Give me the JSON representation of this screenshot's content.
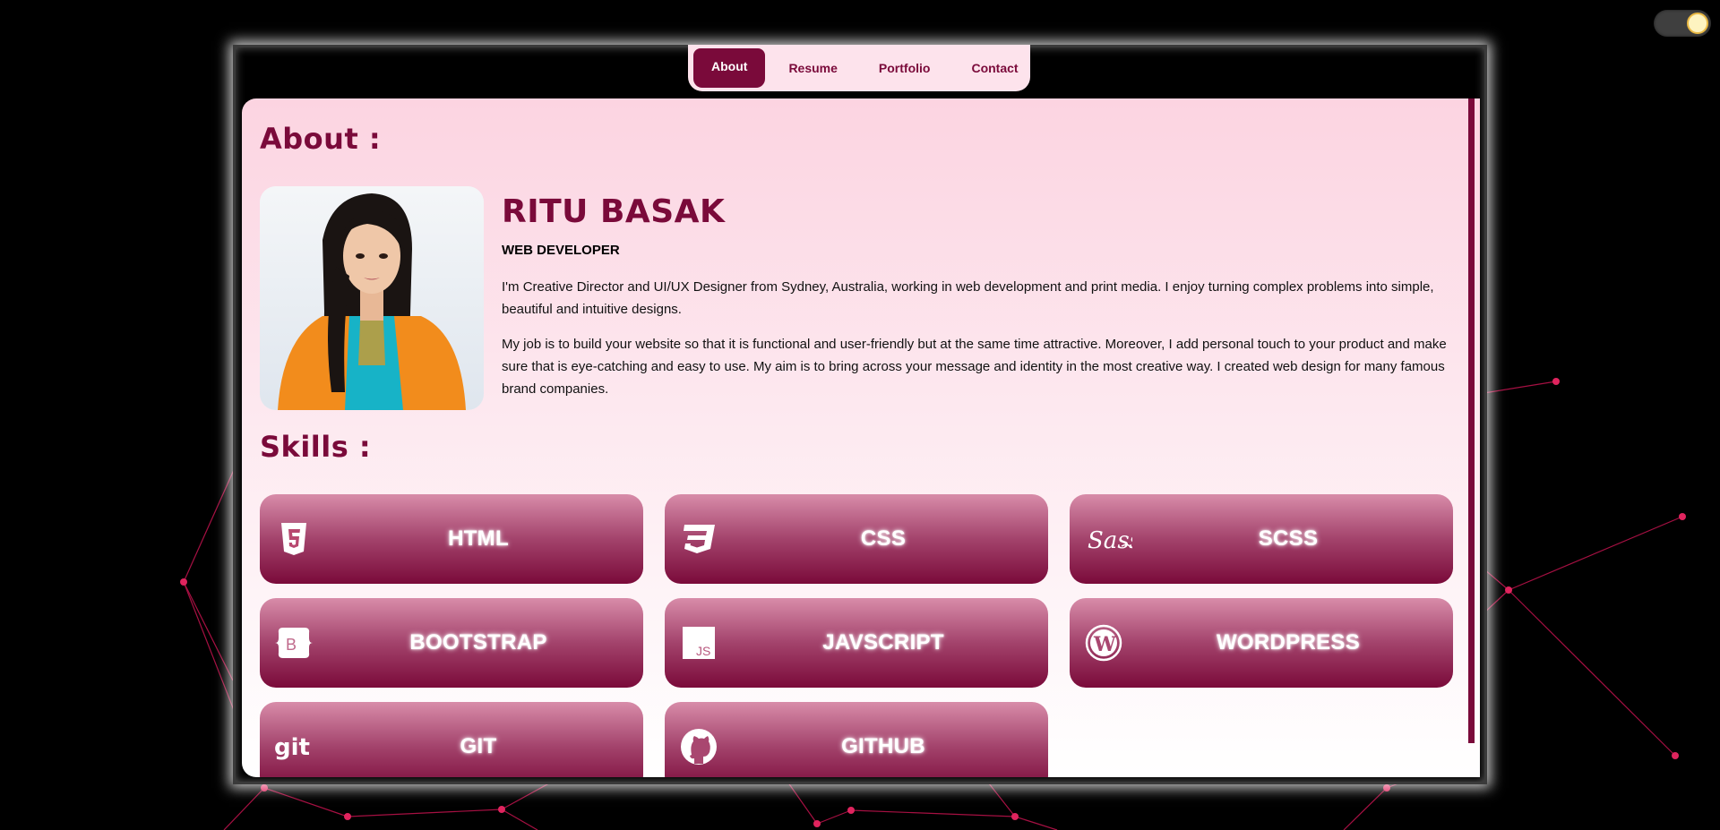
{
  "nav": {
    "items": [
      {
        "label": "About",
        "active": true
      },
      {
        "label": "Resume",
        "active": false
      },
      {
        "label": "Portfolio",
        "active": false
      },
      {
        "label": "Contact",
        "active": false
      }
    ]
  },
  "theme_toggle": {
    "state": "on",
    "icon": "sun-toggle-icon"
  },
  "about": {
    "title": "About :",
    "name": "RITU BASAK",
    "role": "WEB DEVELOPER",
    "paragraphs": [
      "I'm Creative Director and UI/UX Designer from Sydney, Australia, working in web development and print media. I enjoy turning complex problems into simple, beautiful and intuitive designs.",
      "My job is to build your website so that it is functional and user-friendly but at the same time attractive. Moreover, I add personal touch to your product and make sure that is eye-catching and easy to use. My aim is to bring across your message and identity in the most creative way. I created web design for many famous brand companies."
    ]
  },
  "skills": {
    "title": "Skills :",
    "items": [
      {
        "label": "HTML",
        "icon": "html5-icon"
      },
      {
        "label": "CSS",
        "icon": "css3-icon"
      },
      {
        "label": "SCSS",
        "icon": "sass-icon"
      },
      {
        "label": "BOOTSTRAP",
        "icon": "bootstrap-icon"
      },
      {
        "label": "JAVSCRIPT",
        "icon": "javascript-icon"
      },
      {
        "label": "WORDPRESS",
        "icon": "wordpress-icon"
      },
      {
        "label": "GIT",
        "icon": "git-icon"
      },
      {
        "label": "GITHUB",
        "icon": "github-icon"
      }
    ]
  },
  "colors": {
    "accent": "#7a0a3a",
    "panel_top": "#fcd4e1",
    "network_line": "#e0245e"
  }
}
